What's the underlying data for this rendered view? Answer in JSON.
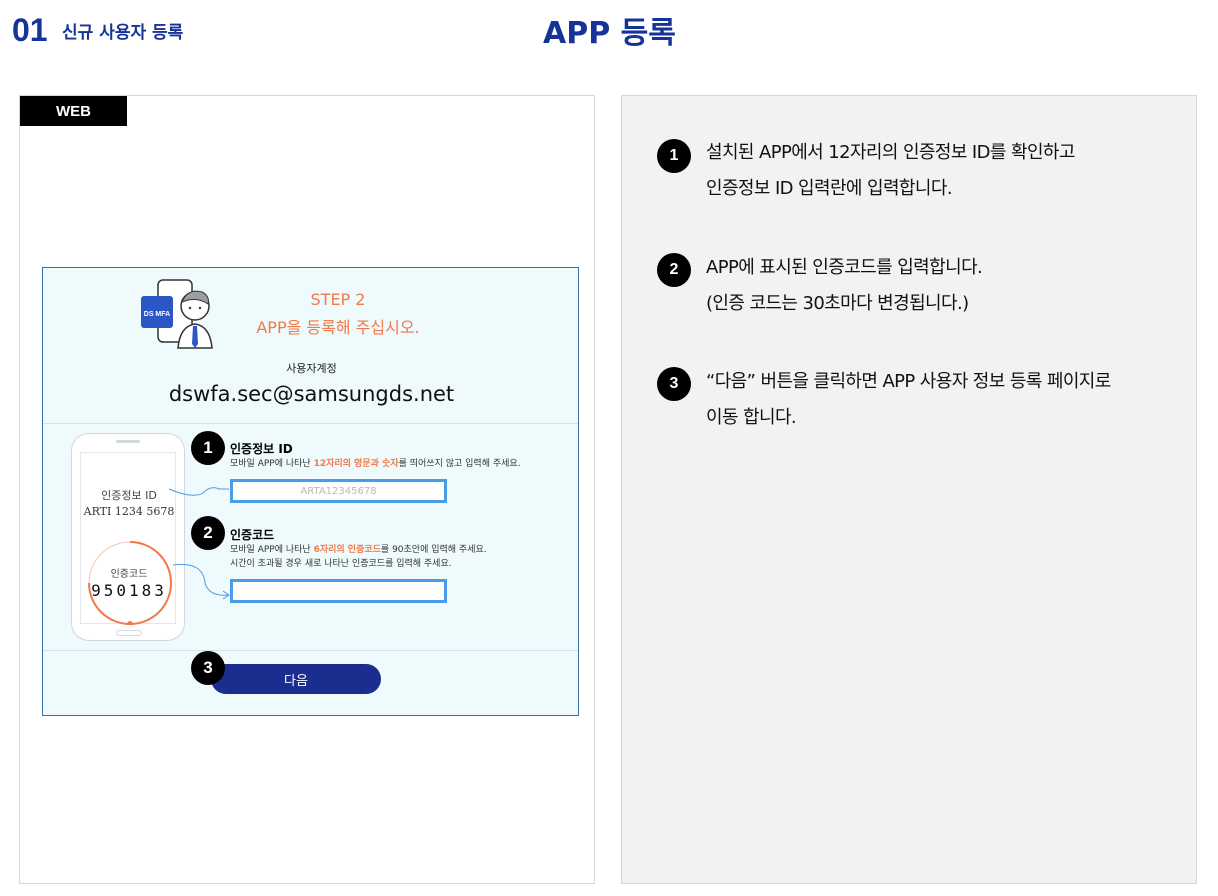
{
  "header": {
    "number": "01",
    "subtitle": "신규 사용자 등록",
    "title": "APP 등록"
  },
  "left": {
    "tag": "WEB",
    "screenshot": {
      "app_badge": "DS MFA",
      "step_title": "STEP 2",
      "step_subtitle": "APP을 등록해 주십시오.",
      "account_label": "사용자계정",
      "account_email": "dswfa.sec@samsungds.net",
      "phone": {
        "id_label": "인증정보 ID",
        "id_value": "ARTI 1234 5678",
        "code_label": "인증코드",
        "code_value": "950183"
      },
      "fields": [
        {
          "badge": "1",
          "title": "인증정보 ID",
          "desc_prefix": "모바일 APP에 나타난 ",
          "desc_highlight": "12자리의 영문과 숫자",
          "desc_suffix": "를 띄어쓰지 않고 입력해 주세요.",
          "desc_line2": "",
          "placeholder": "ARTA12345678"
        },
        {
          "badge": "2",
          "title": "인증코드",
          "desc_prefix": "모바일 APP에 나타난 ",
          "desc_highlight": "6자리의 인증코드",
          "desc_suffix": "를 90초안에 입력해 주세요.",
          "desc_line2": "시간이 초과될 경우 새로 나타난 인증코드를 입력해 주세요.",
          "placeholder": ""
        }
      ],
      "next_badge": "3",
      "next_label": "다음"
    }
  },
  "right": {
    "steps": [
      {
        "badge": "1",
        "line1": "설치된 APP에서 12자리의 인증정보 ID를 확인하고",
        "line2": "인증정보 ID 입력란에 입력합니다."
      },
      {
        "badge": "2",
        "line1": "APP에 표시된 인증코드를 입력합니다.",
        "line2": "(인증 코드는 30초마다 변경됩니다.)"
      },
      {
        "badge": "3",
        "line1": "“다음” 버튼을 클릭하면 APP 사용자 정보 등록 페이지로",
        "line2": "이동 합니다."
      }
    ]
  },
  "colors": {
    "brand": "#16339a",
    "accent": "#f07a4a",
    "input_border": "#4a9be8",
    "button": "#1b2e8f"
  }
}
